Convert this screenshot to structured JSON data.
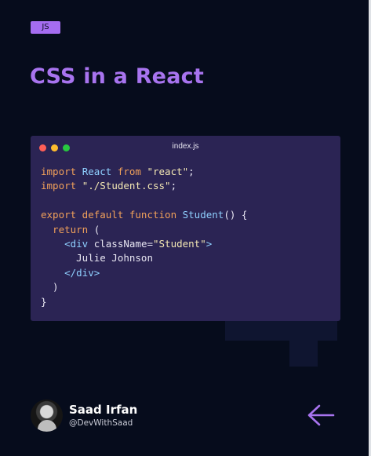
{
  "tag": "JS",
  "title": "CSS in a React",
  "editor": {
    "filename": "index.js",
    "lines": [
      [
        {
          "t": "import ",
          "c": "kw"
        },
        {
          "t": "React ",
          "c": "id"
        },
        {
          "t": "from ",
          "c": "kw"
        },
        {
          "t": "\"react\"",
          "c": "str"
        },
        {
          "t": ";",
          "c": "plain"
        }
      ],
      [
        {
          "t": "import ",
          "c": "kw"
        },
        {
          "t": "\"./Student.css\"",
          "c": "str"
        },
        {
          "t": ";",
          "c": "plain"
        }
      ],
      [],
      [
        {
          "t": "export default function ",
          "c": "kw"
        },
        {
          "t": "Student",
          "c": "id"
        },
        {
          "t": "() {",
          "c": "plain"
        }
      ],
      [
        {
          "t": "  return ",
          "c": "kw"
        },
        {
          "t": "(",
          "c": "plain"
        }
      ],
      [
        {
          "t": "    <div ",
          "c": "tagc"
        },
        {
          "t": "className=",
          "c": "attr"
        },
        {
          "t": "\"Student\"",
          "c": "str"
        },
        {
          "t": ">",
          "c": "tagc"
        }
      ],
      [
        {
          "t": "      Julie Johnson",
          "c": "plain"
        }
      ],
      [
        {
          "t": "    </div>",
          "c": "tagc"
        }
      ],
      [
        {
          "t": "  )",
          "c": "plain"
        }
      ],
      [
        {
          "t": "}",
          "c": "plain"
        }
      ]
    ]
  },
  "author": {
    "name": "Saad Irfan",
    "handle": "@DevWithSaad"
  },
  "nav": {
    "back_icon": "arrow-left-icon"
  },
  "colors": {
    "background": "#060c1c",
    "accent": "#a874ef",
    "editor_bg": "#2b2454"
  }
}
